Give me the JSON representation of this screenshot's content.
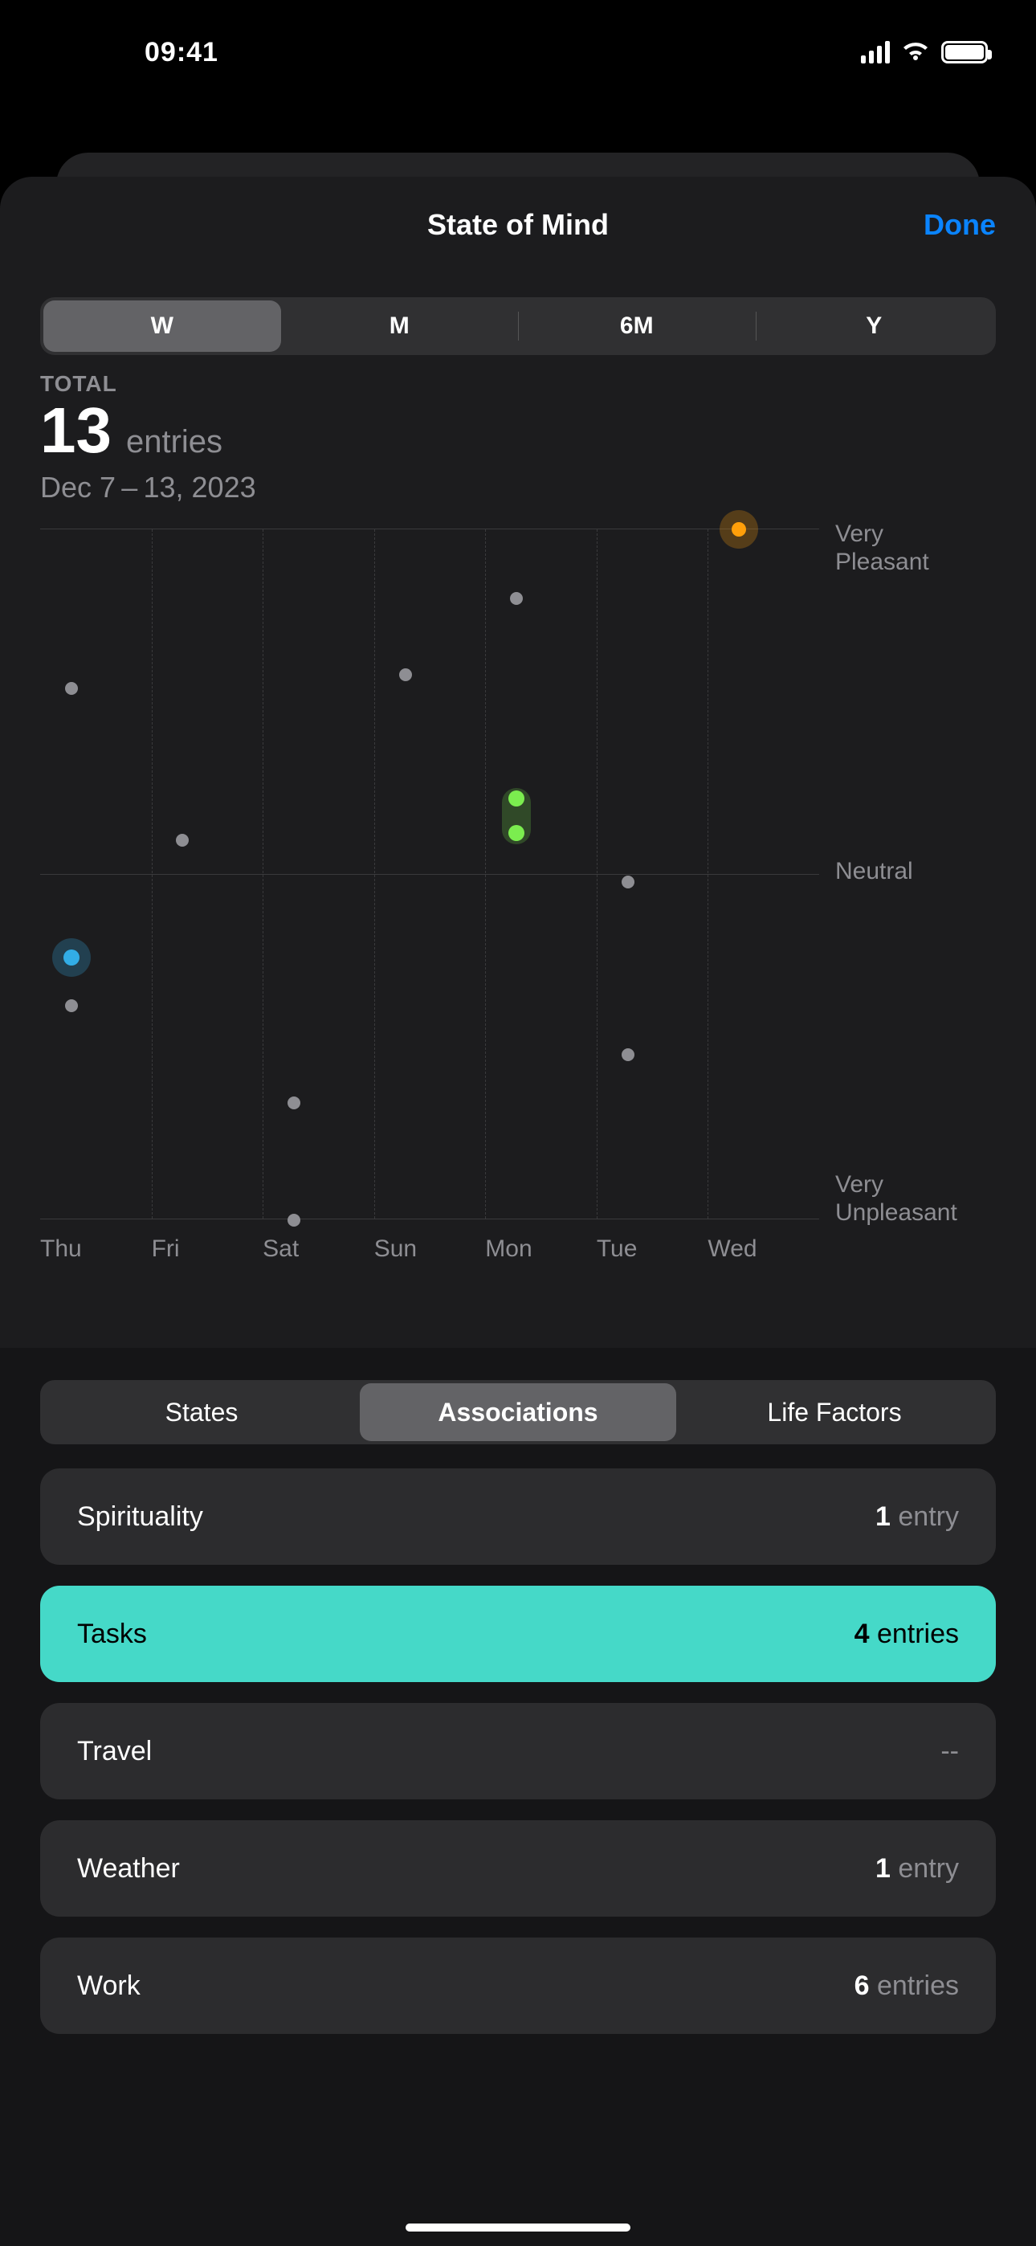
{
  "status_bar": {
    "time": "09:41"
  },
  "nav": {
    "title": "State of Mind",
    "done": "Done"
  },
  "time_range_segments": [
    "W",
    "M",
    "6M",
    "Y"
  ],
  "time_range_selected_index": 0,
  "summary": {
    "label": "TOTAL",
    "value": "13",
    "unit": "entries",
    "date_range": "Dec 7 – 13, 2023"
  },
  "chart_data": {
    "type": "scatter",
    "x_categories": [
      "Thu",
      "Fri",
      "Sat",
      "Sun",
      "Mon",
      "Tue",
      "Wed"
    ],
    "y_axis_labels": {
      "top": "Very\nPleasant",
      "mid": "Neutral",
      "bottom": "Very\nUnpleasant"
    },
    "y_range": [
      -1,
      1
    ],
    "points": [
      {
        "day_index": 0,
        "y": 0.54,
        "kind": "gray"
      },
      {
        "day_index": 0,
        "y": -0.24,
        "kind": "blue",
        "halo": true
      },
      {
        "day_index": 0,
        "y": -0.38,
        "kind": "gray"
      },
      {
        "day_index": 1,
        "y": 0.1,
        "kind": "gray"
      },
      {
        "day_index": 2,
        "y": -0.66,
        "kind": "gray"
      },
      {
        "day_index": 2,
        "y": -1.0,
        "kind": "gray"
      },
      {
        "day_index": 3,
        "y": 0.58,
        "kind": "gray"
      },
      {
        "day_index": 4,
        "y": 0.8,
        "kind": "gray"
      },
      {
        "day_index": 4,
        "y": 0.22,
        "kind": "green",
        "pill_group": "mon"
      },
      {
        "day_index": 4,
        "y": 0.12,
        "kind": "green",
        "pill_group": "mon"
      },
      {
        "day_index": 5,
        "y": -0.02,
        "kind": "gray"
      },
      {
        "day_index": 5,
        "y": -0.52,
        "kind": "gray"
      },
      {
        "day_index": 6,
        "y": 1.0,
        "kind": "orange",
        "halo": true
      }
    ]
  },
  "category_segments": [
    "States",
    "Associations",
    "Life Factors"
  ],
  "category_selected_index": 1,
  "associations": [
    {
      "name": "Spirituality",
      "count": 1,
      "count_text": "1 entry"
    },
    {
      "name": "Tasks",
      "count": 4,
      "count_text": "4 entries",
      "highlighted": true
    },
    {
      "name": "Travel",
      "count": null,
      "count_text": "--"
    },
    {
      "name": "Weather",
      "count": 1,
      "count_text": "1 entry"
    },
    {
      "name": "Work",
      "count": 6,
      "count_text": "6 entries"
    }
  ]
}
